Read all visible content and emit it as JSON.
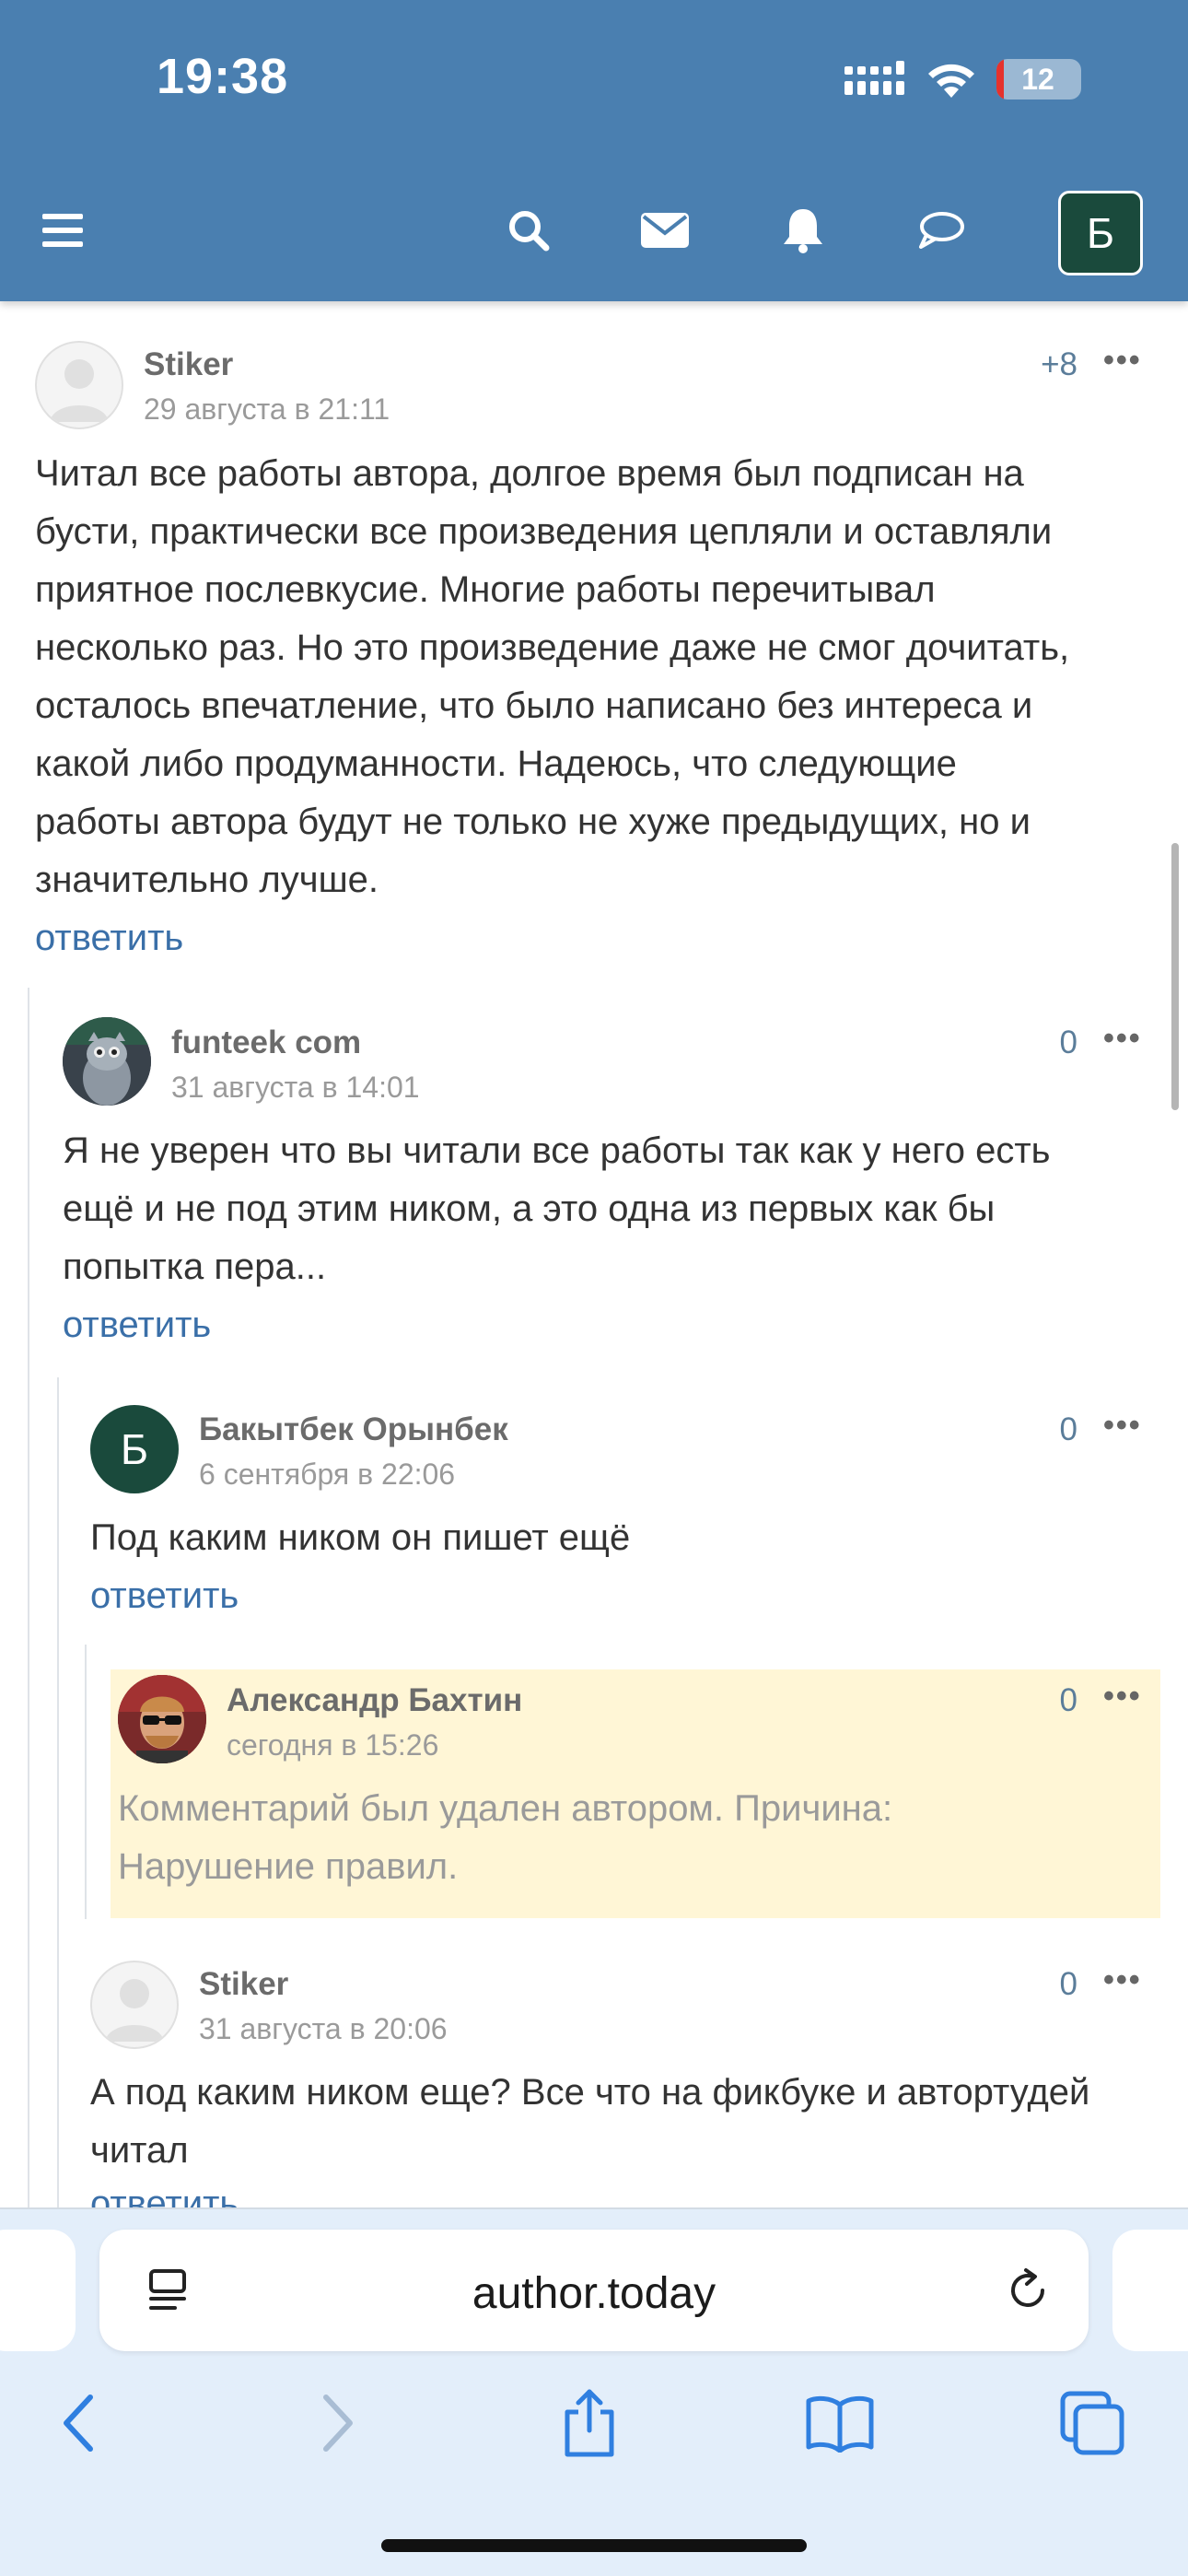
{
  "status_bar": {
    "time": "19:38",
    "battery": "12"
  },
  "header": {
    "avatar_letter": "Б"
  },
  "comments": [
    {
      "author": "Stiker",
      "date": "29 августа в 21:11",
      "score": "+8",
      "more": "•••",
      "lines": [
        "Читал все работы автора, долгое время был подписан на",
        "бусти, практически все произведения цепляли и оставляли",
        "приятное послевкусие. Многие работы перечитывал",
        "несколько раз. Но это произведение даже не смог дочитать,",
        "осталось впечатление, что было написано без интереса и",
        "какой либо продуманности. Надеюсь, что следующие",
        "работы автора будут не только не хуже предыдущих, но и",
        "значительно лучше."
      ],
      "reply": "ответить"
    },
    {
      "author": "funteek com",
      "date": "31 августа в 14:01",
      "score": "0",
      "more": "•••",
      "lines": [
        "Я не уверен что вы читали все работы так как у него есть",
        "ещё и не под этим ником, а это одна из первых как бы",
        "попытка пера..."
      ],
      "reply": "ответить"
    },
    {
      "author": "Бакытбек Орынбек",
      "avatar_letter": "Б",
      "date": "6 сентября в 22:06",
      "score": "0",
      "more": "•••",
      "lines": [
        "Под каким ником он пишет ещё"
      ],
      "reply": "ответить"
    },
    {
      "author": "Александр Бахтин",
      "date": "сегодня в 15:26",
      "score": "0",
      "more": "•••",
      "lines": [
        "Комментарий был удален автором. Причина:",
        "Нарушение правил."
      ]
    },
    {
      "author": "Stiker",
      "date": "31 августа в 20:06",
      "score": "0",
      "more": "•••",
      "lines": [
        "А под каким ником еще? Все что на фикбуке и автортудей",
        "читал"
      ],
      "reply": "ответить"
    }
  ],
  "browser": {
    "url": "author.today"
  },
  "colors": {
    "header_bg": "#4a7fb0",
    "link": "#3a6fa8",
    "deleted_bg": "#fff6d6",
    "avatar_bg": "#1a4a3c"
  }
}
